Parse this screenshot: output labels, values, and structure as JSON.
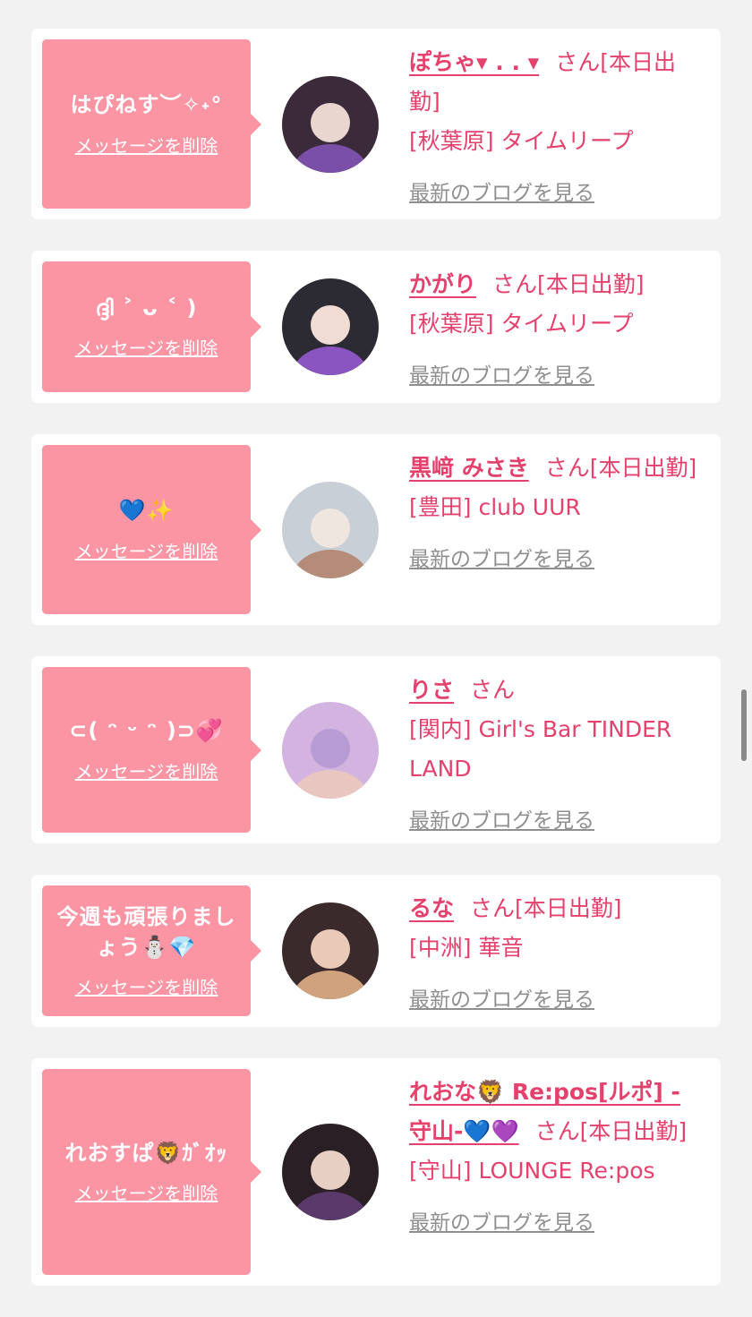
{
  "cards": [
    {
      "bubble_message": "はぴねす︶✧˖°",
      "delete_label": "メッセージを削除",
      "name": "ぽちゃ▾ .  . ▾",
      "suffix": "さん[本日出勤]",
      "shop": "[秋葉原] タイムリープ",
      "blog_link": "最新のブログを見る",
      "avatar_colors": [
        "#3a2a3a",
        "#7a4fa8",
        "#e9d7cf"
      ]
    },
    {
      "bubble_message": "ദ്ദി ˃ ᴗ ˂ )",
      "delete_label": "メッセージを削除",
      "name": "かがり",
      "suffix": "さん[本日出勤]",
      "shop": "[秋葉原] タイムリープ",
      "blog_link": "最新のブログを見る",
      "avatar_colors": [
        "#2c2b33",
        "#8a55c0",
        "#f0dcd3"
      ]
    },
    {
      "bubble_message": "💙✨",
      "delete_label": "メッセージを削除",
      "name": "黒﨑 みさき",
      "suffix": "さん[本日出勤]",
      "shop": "[豊田] club UUR",
      "blog_link": "最新のブログを見る",
      "avatar_colors": [
        "#c9cfd6",
        "#b48c79",
        "#eee6df"
      ]
    },
    {
      "bubble_message": "⊂( ᵔ ᵕ ᵔ )⊃💞",
      "delete_label": "メッセージを削除",
      "name": "りさ",
      "suffix": "さん",
      "shop": "[関内] Girl's Bar TINDER LAND",
      "blog_link": "最新のブログを見る",
      "avatar_colors": [
        "#d3b3df",
        "#e9c7c0",
        "#b69bd4"
      ]
    },
    {
      "bubble_message": "今週も頑張りましょう⛄💎",
      "delete_label": "メッセージを削除",
      "name": "るな",
      "suffix": "さん[本日出勤]",
      "shop": "[中洲] 華音",
      "blog_link": "最新のブログを見る",
      "avatar_colors": [
        "#3b2a2c",
        "#d1a27e",
        "#e9c9b7"
      ]
    },
    {
      "bubble_message": "れおすぱ🦁ｶﾞｵｯ",
      "delete_label": "メッセージを削除",
      "name": "れおな🦁 Re:pos[ルポ] -守山-💙💜",
      "suffix": "さん[本日出勤]",
      "shop": "[守山] LOUNGE Re:pos",
      "blog_link": "最新のブログを見る",
      "avatar_colors": [
        "#2a1f24",
        "#5a3a6a",
        "#e7cfc4"
      ]
    }
  ]
}
